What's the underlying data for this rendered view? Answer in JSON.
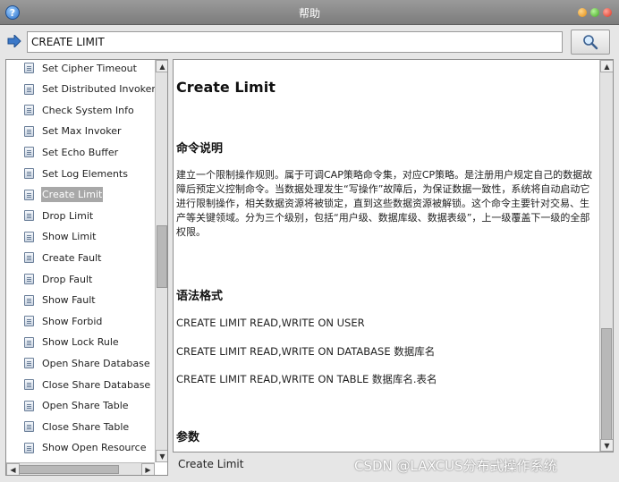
{
  "window": {
    "title": "帮助"
  },
  "search": {
    "value": "CREATE LIMIT"
  },
  "tree": {
    "selected_index": 6,
    "items": [
      "Set Cipher Timeout",
      "Set Distributed Invoker Ti",
      "Check System Info",
      "Set Max Invoker",
      "Set Echo Buffer",
      "Set Log Elements",
      "Create Limit",
      "Drop Limit",
      "Show Limit",
      "Create Fault",
      "Drop Fault",
      "Show Fault",
      "Show Forbid",
      "Show Lock Rule",
      "Open Share Database",
      "Close Share Database",
      "Open Share Table",
      "Close Share Table",
      "Show Open Resource"
    ]
  },
  "doc": {
    "title": "Create Limit",
    "section_desc": "命令说明",
    "description": "建立一个限制操作规则。属于可调CAP策略命令集，对应CP策略。是注册用户规定自己的数据故障后预定义控制命令。当数据处理发生“写操作”故障后，为保证数据一致性，系统将自动启动它进行限制操作，相关数据资源将被锁定，直到这些数据资源被解锁。这个命令主要针对交易、生产等关键领域。分为三个级别，包括“用户级、数据库级、数据表级”，上一级覆盖下一级的全部权限。",
    "section_syntax": "语法格式",
    "syntax": [
      "CREATE LIMIT READ,WRITE ON USER",
      "CREATE LIMIT READ,WRITE ON DATABASE 数据库名",
      "CREATE LIMIT READ,WRITE ON TABLE 数据库名.表名"
    ],
    "section_params": "参数"
  },
  "status": {
    "text": "Create Limit"
  },
  "watermark": "CSDN @LAXCUS分布式操作系统",
  "icons": {
    "app": "help-icon",
    "go": "arrow-right-icon",
    "search": "magnifier-icon",
    "doc": "document-icon"
  }
}
